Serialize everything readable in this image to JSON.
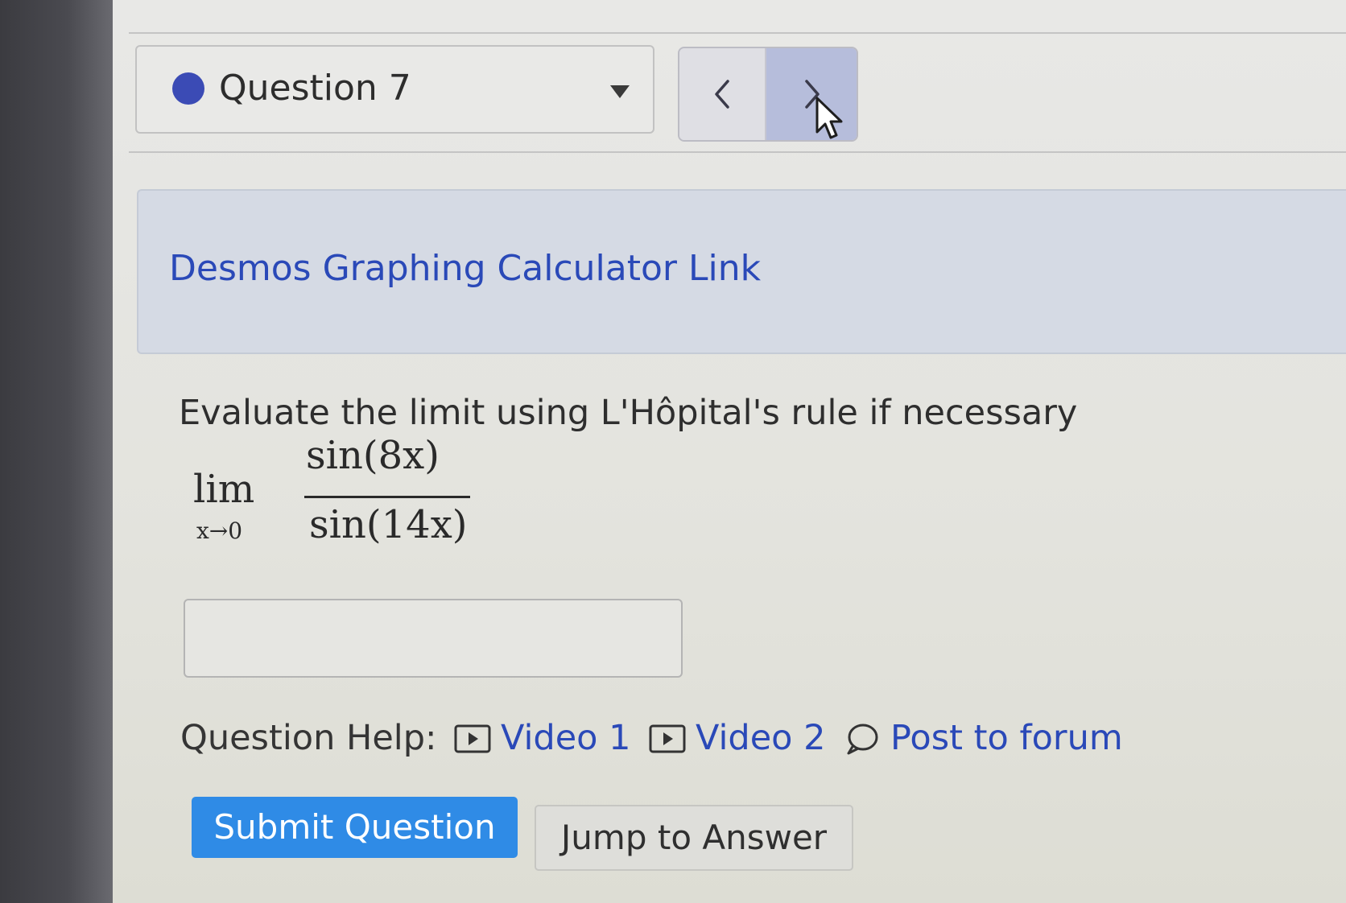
{
  "question_nav": {
    "selected_question": "Question 7",
    "status_color": "#3b4bb5"
  },
  "desmos": {
    "link_text": "Desmos Graphing Calculator Link"
  },
  "question": {
    "prompt": "Evaluate the limit using L'Hôpital's rule if necessary",
    "limit_word": "lim",
    "limit_subscript": "x→0",
    "numerator": "sin(8x)",
    "denominator": "sin(14x)"
  },
  "answer": {
    "value": ""
  },
  "help": {
    "label": "Question Help:",
    "video1": "Video 1",
    "video2": "Video 2",
    "forum": "Post to forum"
  },
  "actions": {
    "submit": "Submit Question",
    "jump": "Jump to Answer"
  },
  "colors": {
    "link": "#2a49b8",
    "submit_bg": "#2f8be6",
    "next_button_bg": "#b6bddb"
  }
}
